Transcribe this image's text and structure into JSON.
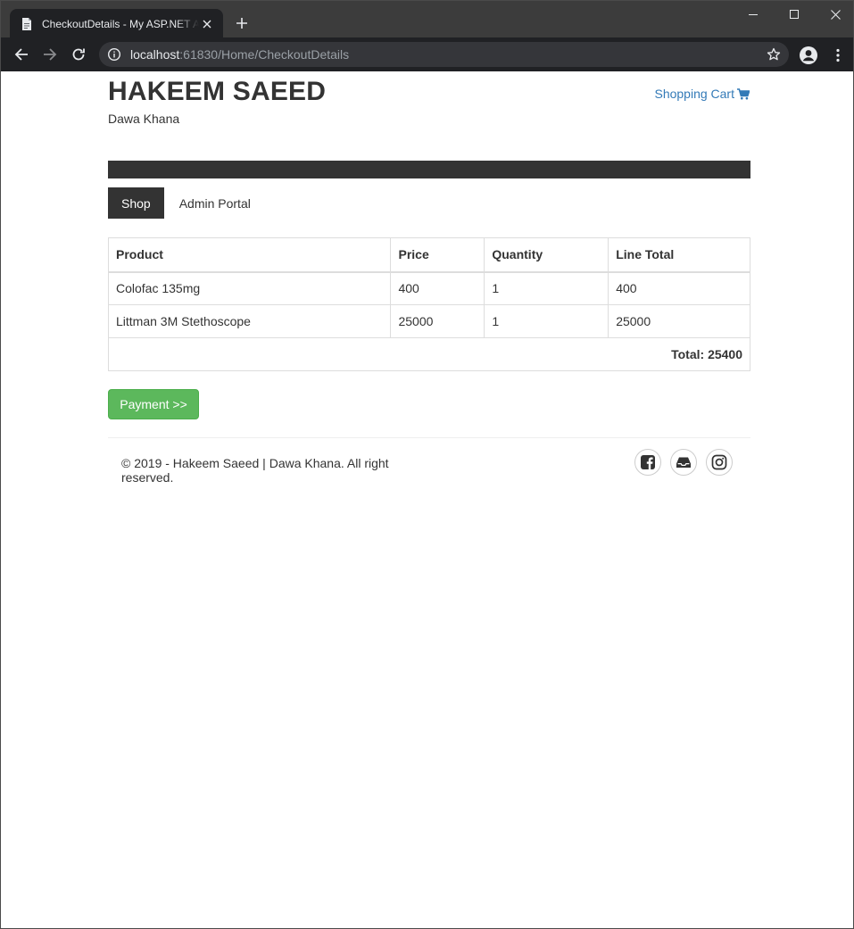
{
  "browser": {
    "tab_title": "CheckoutDetails - My ASP.NET Application",
    "url_host": "localhost",
    "url_rest": ":61830/Home/CheckoutDetails"
  },
  "header": {
    "brand": "HAKEEM SAEED",
    "subtitle": "Dawa Khana",
    "cart_label": "Shopping Cart"
  },
  "nav": {
    "items": [
      {
        "label": "Shop",
        "active": true
      },
      {
        "label": "Admin Portal",
        "active": false
      }
    ]
  },
  "cart_table": {
    "headers": [
      "Product",
      "Price",
      "Quantity",
      "Line Total"
    ],
    "rows": [
      [
        "Colofac 135mg",
        "400",
        "1",
        "400"
      ],
      [
        "Littman 3M Stethoscope",
        "25000",
        "1",
        "25000"
      ]
    ],
    "total_label": "Total: 25400"
  },
  "payment_button": "Payment >>",
  "footer": {
    "copyright": "© 2019 - Hakeem Saeed | Dawa Khana. All right reserved.",
    "social": [
      "facebook-icon",
      "inbox-icon",
      "instagram-icon"
    ]
  },
  "colors": {
    "link": "#337ab7",
    "dark": "#333333",
    "success": "#5cb85c"
  }
}
